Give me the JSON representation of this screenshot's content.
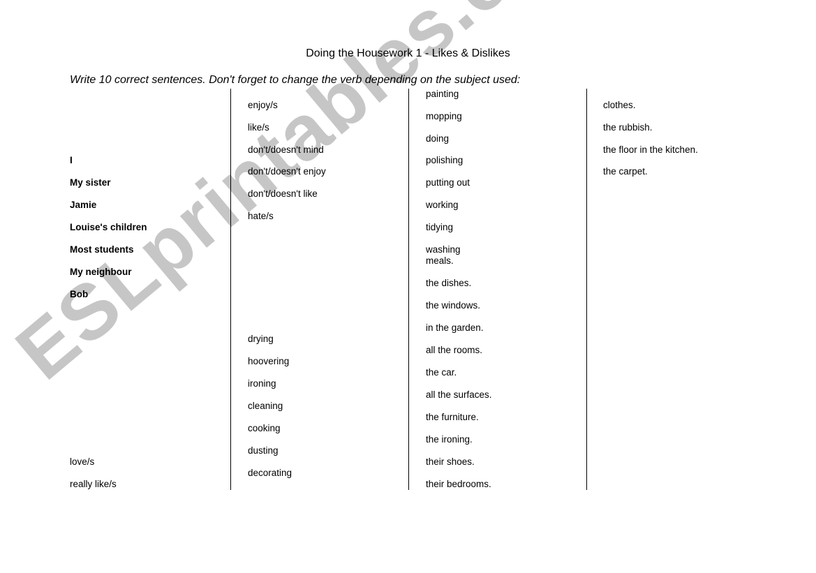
{
  "title": "Doing the Housework 1 - Likes & Dislikes",
  "instructions": "Write 10 correct sentences.  Don't forget to change the verb depending on the subject used:",
  "subjects": [
    "I",
    "My sister",
    "Jamie",
    "Louise's children",
    "Most students",
    "My neighbour",
    "Bob"
  ],
  "verbs_extra": [
    "love/s",
    "really like/s"
  ],
  "verbs": [
    "enjoy/s",
    "like/s",
    "don't/doesn't mind",
    "don't/doesn't enjoy",
    "don't/doesn't like",
    "hate/s"
  ],
  "gerunds_col2": [
    "drying",
    "hoovering",
    "ironing",
    "cleaning",
    "cooking",
    "dusting",
    "decorating"
  ],
  "gerunds_col3": [
    "painting",
    "mopping",
    "doing",
    "polishing",
    "putting out",
    "working",
    "tidying",
    "washing"
  ],
  "objects_col3": [
    "meals.",
    "the dishes.",
    "the windows.",
    "in the garden.",
    "all the rooms.",
    "the car.",
    "all the surfaces.",
    "the furniture.",
    "the ironing.",
    "their shoes.",
    "their bedrooms."
  ],
  "objects_col4": [
    "clothes.",
    "the rubbish.",
    "the floor in the kitchen.",
    "the carpet."
  ],
  "watermark": "ESLprintables.com"
}
